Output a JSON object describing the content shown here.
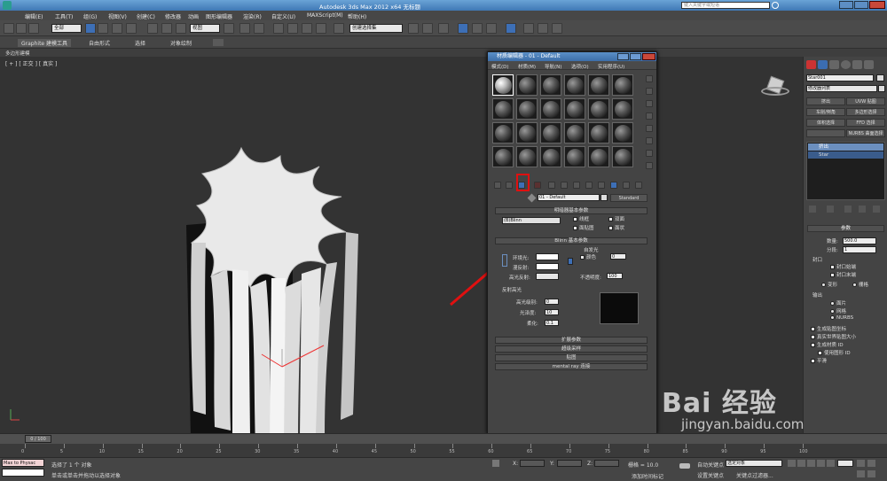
{
  "app": {
    "title": "Autodesk 3ds Max  2012 x64    无标题",
    "search_placeholder": "键入关键字或短语",
    "colors": {
      "accent": "#3d6fb6",
      "arrow": "#e01010",
      "bg": "#3d3d3d"
    }
  },
  "menubar": {
    "items": [
      "编辑(E)",
      "工具(T)",
      "组(G)",
      "视图(V)",
      "创建(C)",
      "修改器",
      "动画",
      "图形编辑器",
      "渲染(R)",
      "自定义(U)",
      "MAXScript(M)",
      "帮助(H)"
    ]
  },
  "toolbar": {
    "selection_filter": "全部",
    "ref_coord": "视图",
    "named_selection": "创建选择集"
  },
  "ribbon": {
    "tabs": [
      "Graphite 建模工具",
      "自由形式",
      "选择",
      "对象绘制"
    ],
    "sub": "多边形建模"
  },
  "viewport": {
    "label": "[ + ] [ 正交 ] [ 真实 ]"
  },
  "material_editor": {
    "title": "材质编辑器 - 01 - Default",
    "menu": [
      "模式(D)",
      "材质(M)",
      "导航(N)",
      "选项(O)",
      "实用程序(U)"
    ],
    "material_name": "01 - Default",
    "material_type": "Standard",
    "shader_rollout": "明暗器基本参数",
    "shader": "(B)Blinn",
    "shader_opts": [
      "线框",
      "双面",
      "面贴图",
      "面状"
    ],
    "blinn_rollout": "Blinn 基本参数",
    "self_illum": "自发光",
    "color_label": "颜色",
    "self_illum_val": "0",
    "ambient": "环境光:",
    "diffuse": "漫反射:",
    "specular": "高光反射:",
    "opacity_label": "不透明度:",
    "opacity": "100",
    "spec_highlights": "反射高光",
    "spec_level_label": "高光级别:",
    "spec_level": "0",
    "gloss_label": "光泽度:",
    "gloss": "10",
    "soften_label": "柔化:",
    "soften": "0.1",
    "rollouts": [
      "扩展参数",
      "超级采样",
      "贴图",
      "mental ray 连接"
    ]
  },
  "command_panel": {
    "object_name": "Star001",
    "modifier_list": "修改器列表",
    "buttons": [
      "挤出",
      "UVW 贴图",
      "车削/倒角",
      "多边形选择",
      "体积选择",
      "FFD 选择",
      "",
      "NURBS 曲面选择"
    ],
    "stack": [
      "挤出",
      "Star"
    ],
    "params_head": "参数",
    "amount_label": "数量:",
    "amount": "500.0",
    "segments_label": "分段:",
    "segments": "1",
    "cap_head": "封口",
    "cap_start": "封口始端",
    "cap_end": "封口末端",
    "morph": "变形",
    "grid": "栅格",
    "output_head": "输出",
    "out_patch": "面片",
    "out_mesh": "网格",
    "out_nurbs": "NURBS",
    "gen_mapping": "生成贴图坐标",
    "real_world": "真实世界贴图大小",
    "gen_mat_ids": "生成材质 ID",
    "use_shape_ids": "使用图形 ID",
    "smooth": "平滑"
  },
  "timeline": {
    "frame": "0 / 100",
    "ticks": [
      "0",
      "5",
      "10",
      "15",
      "20",
      "25",
      "30",
      "35",
      "40",
      "45",
      "50",
      "55",
      "60",
      "65",
      "70",
      "75",
      "80",
      "85",
      "90",
      "95",
      "100"
    ]
  },
  "status": {
    "script_box": "Max to Physac",
    "msg1": "选择了 1 个 对象",
    "msg2": "单击或单击并拖动以选择对象",
    "grid": "栅格 = 10.0",
    "autokey": "自动关键点",
    "selected": "选定对象",
    "setkey": "设置关键点",
    "keyfilters": "关键点过滤器...",
    "add_time_tag": "添加时间标记",
    "x": "X:",
    "y": "Y:",
    "z": "Z:"
  },
  "watermark": {
    "brand": "Bai 经验",
    "url": "jingyan.baidu.com"
  }
}
